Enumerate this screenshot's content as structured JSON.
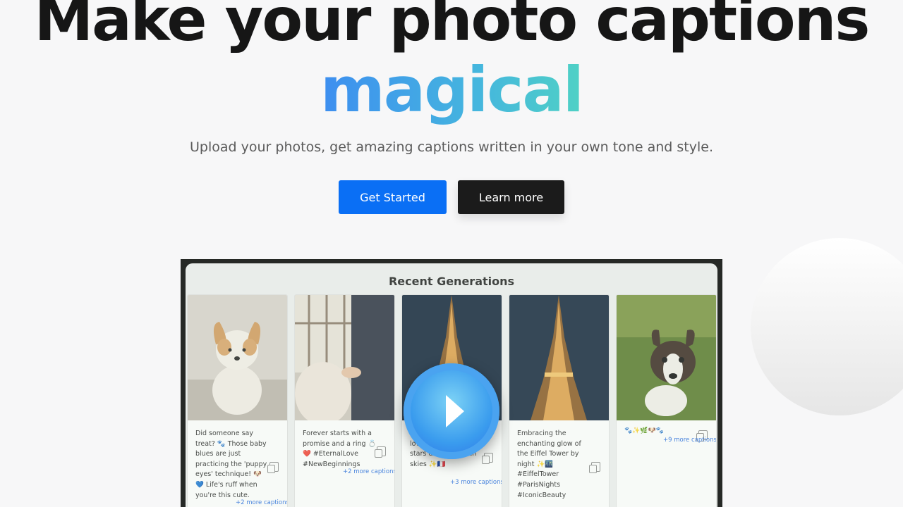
{
  "hero": {
    "line1": "Make your photo captions",
    "line2": "magical",
    "subtitle": "Upload your photos, get amazing captions written in your own tone and style."
  },
  "buttons": {
    "primary": "Get Started",
    "secondary": "Learn more"
  },
  "video": {
    "section_title": "Recent Generations",
    "play_icon": "play-icon",
    "cards": [
      {
        "photo": "corgi-puppy",
        "caption": "Did someone say treat? 🐾 Those baby blues are just practicing the 'puppy eyes' technique! 🐶💙 Life's ruff when you're this cute.",
        "more": "+2 more captions"
      },
      {
        "photo": "couple-ring",
        "caption": "Forever starts with a promise and a ring 💍❤️ #EternalLove #NewBeginnings",
        "more": "+2 more captions"
      },
      {
        "photo": "eiffel-tower-night",
        "caption": "glowing nights where love sparkles like stars under Parisian skies ✨🇫🇷",
        "more": "+3 more captions"
      },
      {
        "photo": "eiffel-tower-night",
        "caption": "Embracing the enchanting glow of the Eiffel Tower by night ✨🌃 #EiffelTower #ParisNights #IconicBeauty",
        "more": ""
      },
      {
        "photo": "boston-terrier-grass",
        "caption": "🐾✨🌿🐶🐾",
        "more": "+9 more captions"
      }
    ]
  },
  "colors": {
    "primary_button": "#0a6ff5",
    "dark_button": "#1b1b1b",
    "gradient_start": "#3d8ef0",
    "gradient_end": "#4fd1c5"
  }
}
